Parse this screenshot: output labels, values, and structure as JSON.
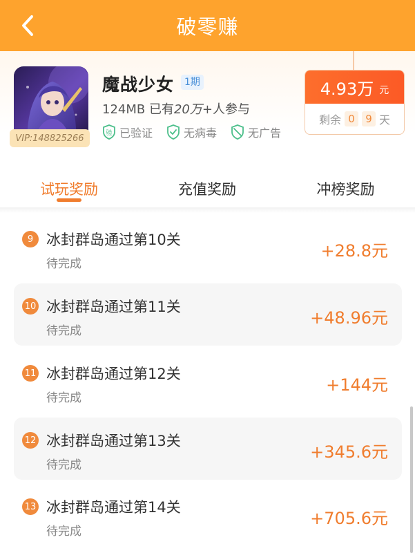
{
  "header": {
    "title": "破零赚"
  },
  "app": {
    "name": "魔战少女",
    "period": "1期",
    "size": "124MB",
    "meta_prefix": "已有",
    "participants": "20万",
    "meta_suffix": "+人参与",
    "vip": "VIP:148825266",
    "tags": [
      {
        "label": "已验证",
        "icon": "verified-icon"
      },
      {
        "label": "无病毒",
        "icon": "shield-check-icon"
      },
      {
        "label": "无广告",
        "icon": "no-ads-icon"
      }
    ]
  },
  "reward": {
    "amount": "4.93万",
    "unit": "元",
    "remaining_label": "剩余",
    "days_digits": [
      "0",
      "9"
    ],
    "days_unit": "天"
  },
  "tabs": [
    {
      "label": "试玩奖励",
      "active": true
    },
    {
      "label": "充值奖励",
      "active": false
    },
    {
      "label": "冲榜奖励",
      "active": false
    }
  ],
  "tasks": [
    {
      "num": "9",
      "title": "冰封群岛通过第10关",
      "status": "待完成",
      "reward": "+28.8元"
    },
    {
      "num": "10",
      "title": "冰封群岛通过第11关",
      "status": "待完成",
      "reward": "+48.96元"
    },
    {
      "num": "11",
      "title": "冰封群岛通过第12关",
      "status": "待完成",
      "reward": "+144元"
    },
    {
      "num": "12",
      "title": "冰封群岛通过第13关",
      "status": "待完成",
      "reward": "+345.6元"
    },
    {
      "num": "13",
      "title": "冰封群岛通过第14关",
      "status": "待完成",
      "reward": "+705.6元"
    }
  ],
  "colors": {
    "header": "#fea32d",
    "accent": "#f07d2e",
    "reward_bg": "#fc5a26",
    "verified": "#4cbf8a"
  }
}
